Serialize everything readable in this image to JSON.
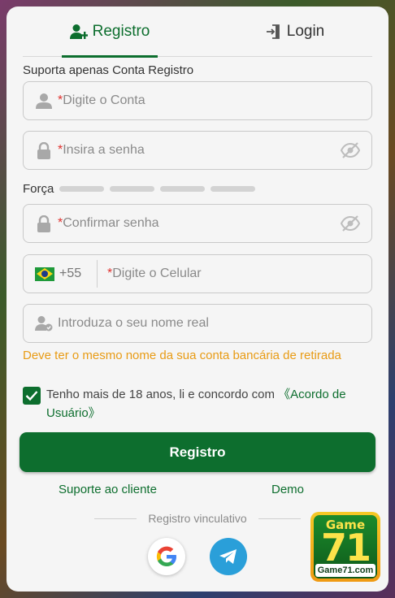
{
  "tabs": {
    "register": "Registro",
    "login": "Login"
  },
  "hint": "Suporta apenas Conta Registro",
  "account": {
    "required_mark": "*",
    "placeholder": "Digite o Conta"
  },
  "password": {
    "required_mark": "*",
    "placeholder": "Insira a senha"
  },
  "strength": {
    "label": "Força"
  },
  "confirm": {
    "required_mark": "*",
    "placeholder": "Confirmar senha"
  },
  "phone": {
    "dial_code": "+55",
    "required_mark": "*",
    "placeholder": "Digite o Celular"
  },
  "real_name": {
    "placeholder": "Introduza o seu nome real"
  },
  "warning": "Deve ter o mesmo nome da sua conta bancária de retirada",
  "agreement": {
    "checked": true,
    "text": "Tenho mais de 18 anos, li e concordo com ",
    "link": "《Acordo de Usuário》"
  },
  "register_button": "Registro",
  "support_link": "Suporte ao cliente",
  "demo_link": "Demo",
  "social_label": "Registro vinculativo",
  "logo": {
    "top": "Game",
    "number": "71",
    "domain": "Game71.com"
  },
  "colors": {
    "accent": "#0d6e2e",
    "warning": "#e89b14",
    "required": "#e0322f"
  },
  "icons": [
    "user-plus-icon",
    "login-door-icon",
    "user-icon",
    "lock-icon",
    "eye-off-icon",
    "brazil-flag-icon",
    "user-check-icon",
    "checkmark-icon",
    "google-icon",
    "telegram-icon"
  ]
}
